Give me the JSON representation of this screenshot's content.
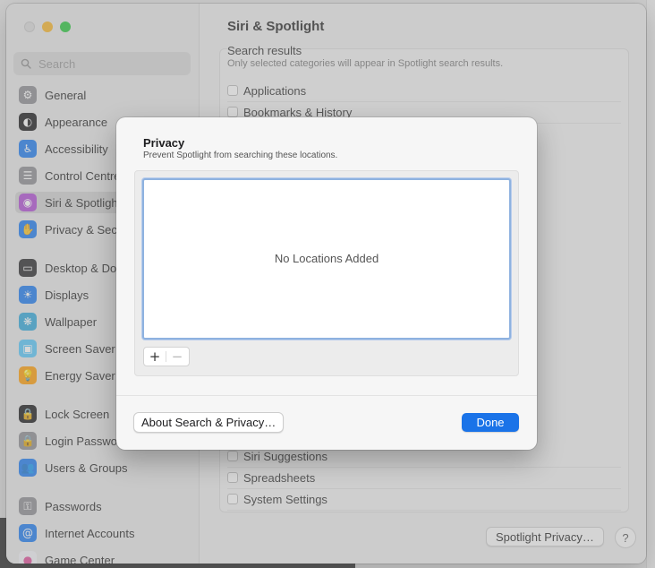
{
  "window": {
    "title": "Siri & Spotlight"
  },
  "search": {
    "placeholder": "Search"
  },
  "sidebar": {
    "items": [
      {
        "label": "General",
        "icon": "gear-icon",
        "color": "#8e8e93",
        "glyph": "⚙"
      },
      {
        "label": "Appearance",
        "icon": "appearance-icon",
        "color": "#1c1c1e",
        "glyph": "◐"
      },
      {
        "label": "Accessibility",
        "icon": "accessibility-icon",
        "color": "#1f7cf0",
        "glyph": "♿"
      },
      {
        "label": "Control Centre",
        "icon": "control-centre-icon",
        "color": "#8e8e93",
        "glyph": "☰"
      },
      {
        "label": "Siri & Spotlight",
        "icon": "siri-icon",
        "color": "#b24fd6",
        "glyph": "◉"
      },
      {
        "label": "Privacy & Security",
        "icon": "privacy-hand-icon",
        "color": "#1f7cf0",
        "glyph": "✋"
      },
      {
        "label": "Desktop & Dock",
        "icon": "desktop-dock-icon",
        "color": "#2c2c2e",
        "glyph": "▭"
      },
      {
        "label": "Displays",
        "icon": "displays-icon",
        "color": "#1f7cf0",
        "glyph": "☀"
      },
      {
        "label": "Wallpaper",
        "icon": "wallpaper-icon",
        "color": "#34aadc",
        "glyph": "❋"
      },
      {
        "label": "Screen Saver",
        "icon": "screen-saver-icon",
        "color": "#5ac8fa",
        "glyph": "▣"
      },
      {
        "label": "Energy Saver",
        "icon": "energy-saver-icon",
        "color": "#ff9f0a",
        "glyph": "💡"
      },
      {
        "label": "Lock Screen",
        "icon": "lock-screen-icon",
        "color": "#1c1c1e",
        "glyph": "🔒"
      },
      {
        "label": "Login Password",
        "icon": "login-password-icon",
        "color": "#8e8e93",
        "glyph": "🔒"
      },
      {
        "label": "Users & Groups",
        "icon": "users-groups-icon",
        "color": "#1f7cf0",
        "glyph": "👥"
      },
      {
        "label": "Passwords",
        "icon": "passwords-key-icon",
        "color": "#8e8e93",
        "glyph": "⚿"
      },
      {
        "label": "Internet Accounts",
        "icon": "internet-accounts-icon",
        "color": "#1f7cf0",
        "glyph": "@"
      },
      {
        "label": "Game Center",
        "icon": "game-center-icon",
        "color": "#f2f2f7",
        "glyph": "●"
      }
    ],
    "active_index": 4
  },
  "main": {
    "results_heading": "Search results",
    "results_sub": "Only selected categories will appear in Spotlight search results.",
    "categories_top": [
      "Applications",
      "Bookmarks & History"
    ],
    "categories_bottom": [
      "Siri Suggestions",
      "Spreadsheets",
      "System Settings"
    ],
    "spotlight_privacy_label": "Spotlight Privacy…",
    "help_label": "?"
  },
  "sheet": {
    "title": "Privacy",
    "subtitle": "Prevent Spotlight from searching these locations.",
    "empty_text": "No Locations Added",
    "add_label": "+",
    "remove_label": "−",
    "about_label": "About Search & Privacy…",
    "done_label": "Done"
  },
  "colors": {
    "accent": "#1a73e8",
    "list_focus_ring": "#8eb2e0"
  }
}
